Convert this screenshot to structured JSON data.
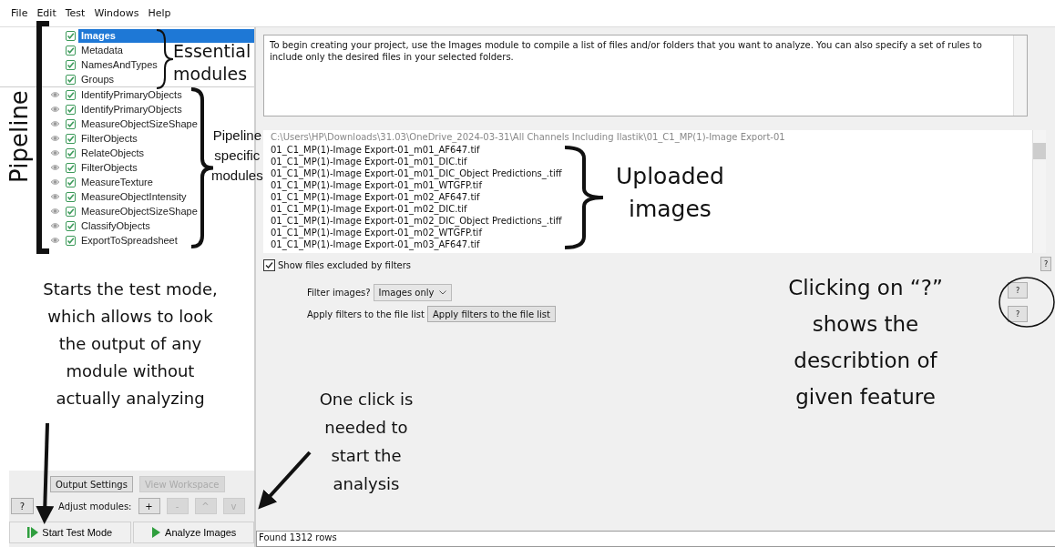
{
  "menu": [
    "File",
    "Edit",
    "Test",
    "Windows",
    "Help"
  ],
  "pipeline": {
    "modules": [
      {
        "name": "Images",
        "kind": "input",
        "checked": true,
        "selected": true
      },
      {
        "name": "Metadata",
        "kind": "input",
        "checked": true,
        "selected": false
      },
      {
        "name": "NamesAndTypes",
        "kind": "input",
        "checked": true,
        "selected": false
      },
      {
        "name": "Groups",
        "kind": "input",
        "checked": true,
        "selected": false
      },
      {
        "name": "IdentifyPrimaryObjects",
        "kind": "analysis",
        "checked": true,
        "selected": false
      },
      {
        "name": "IdentifyPrimaryObjects",
        "kind": "analysis",
        "checked": true,
        "selected": false
      },
      {
        "name": "MeasureObjectSizeShape",
        "kind": "analysis",
        "checked": true,
        "selected": false
      },
      {
        "name": "FilterObjects",
        "kind": "analysis",
        "checked": true,
        "selected": false
      },
      {
        "name": "RelateObjects",
        "kind": "analysis",
        "checked": true,
        "selected": false
      },
      {
        "name": "FilterObjects",
        "kind": "analysis",
        "checked": true,
        "selected": false
      },
      {
        "name": "MeasureTexture",
        "kind": "analysis",
        "checked": true,
        "selected": false
      },
      {
        "name": "MeasureObjectIntensity",
        "kind": "analysis",
        "checked": true,
        "selected": false
      },
      {
        "name": "MeasureObjectSizeShape",
        "kind": "analysis",
        "checked": true,
        "selected": false
      },
      {
        "name": "ClassifyObjects",
        "kind": "analysis",
        "checked": true,
        "selected": false
      },
      {
        "name": "ExportToSpreadsheet",
        "kind": "analysis",
        "checked": true,
        "selected": false
      }
    ]
  },
  "controls": {
    "top_buttons": [
      {
        "label": "Output Settings",
        "disabled": false
      },
      {
        "label": "View Workspace",
        "disabled": true
      }
    ],
    "help": "?",
    "adjust_label": "Adjust modules:",
    "adjust_buttons": [
      {
        "label": "+",
        "disabled": false
      },
      {
        "label": "-",
        "disabled": true
      },
      {
        "label": "^",
        "disabled": true
      },
      {
        "label": "v",
        "disabled": true
      }
    ],
    "run_buttons": [
      {
        "label": "Start Test Mode",
        "kind": "test"
      },
      {
        "label": "Analyze Images",
        "kind": "analyze"
      }
    ]
  },
  "description": "To begin creating your project, use the Images module to compile a list of files and/or folders that you want to analyze. You can also specify a set of rules to include only the desired files in your selected folders.",
  "file_list": {
    "path": "C:\\Users\\HP\\Downloads\\31.03\\OneDrive_2024-03-31\\All Channels Including Ilastik\\01_C1_MP(1)-Image Export-01",
    "files": [
      "01_C1_MP(1)-Image Export-01_m01_AF647.tif",
      "01_C1_MP(1)-Image Export-01_m01_DIC.tif",
      "01_C1_MP(1)-Image Export-01_m01_DIC_Object Predictions_.tiff",
      "01_C1_MP(1)-Image Export-01_m01_WTGFP.tif",
      "01_C1_MP(1)-Image Export-01_m02_AF647.tif",
      "01_C1_MP(1)-Image Export-01_m02_DIC.tif",
      "01_C1_MP(1)-Image Export-01_m02_DIC_Object Predictions_.tiff",
      "01_C1_MP(1)-Image Export-01_m02_WTGFP.tif",
      "01_C1_MP(1)-Image Export-01_m03_AF647.tif"
    ]
  },
  "show_excluded": {
    "label": "Show files excluded by filters",
    "checked": true,
    "help": "?"
  },
  "filter_images": {
    "label": "Filter images?",
    "value": "Images only",
    "help": "?"
  },
  "apply_filters": {
    "label": "Apply filters to the file list",
    "button": "Apply filters to the file list",
    "help": "?"
  },
  "status": "Found 1312 rows",
  "annotations": [
    {
      "kind": "essential",
      "text": "Essential\nmodules"
    },
    {
      "kind": "pipeline",
      "text": "Pipeline"
    },
    {
      "kind": "specific",
      "text": "Pipeline\nspecific\nmodules"
    },
    {
      "kind": "uploaded",
      "text": "Uploaded\nimages"
    },
    {
      "kind": "testmode",
      "text": "Starts the test mode,\nwhich allows to look\nthe output of any\nmodule without\nactually analyzing"
    },
    {
      "kind": "analyze",
      "text": "One click is\nneeded to\nstart the\nanalysis"
    },
    {
      "kind": "help",
      "text": "Clicking on “?”\nshows the\ndescribtion of\ngiven feature"
    }
  ]
}
